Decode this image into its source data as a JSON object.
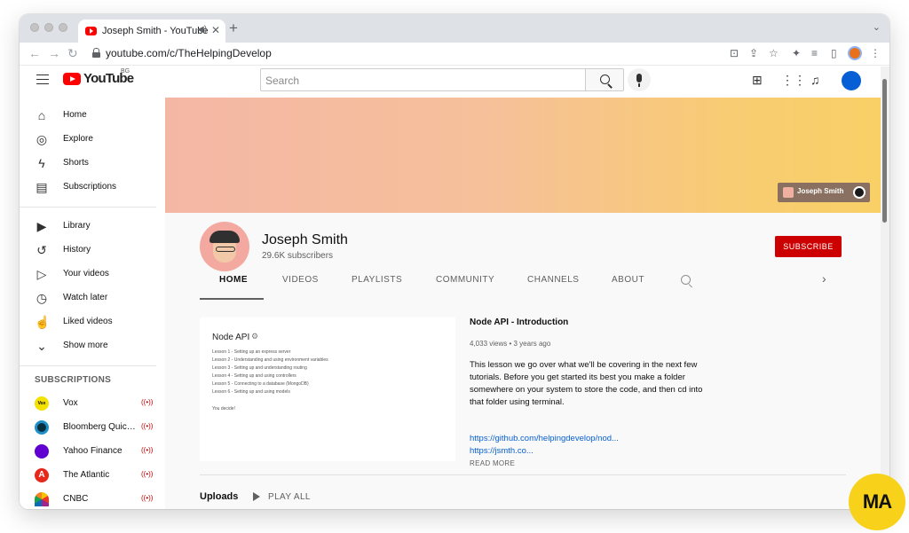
{
  "browser": {
    "tab_title": "Joseph Smith - YouTube",
    "tab_close": "✕",
    "new_tab": "+",
    "url": "youtube.com/c/TheHelpingDevelop"
  },
  "header": {
    "logo_text": "YouTube",
    "country_code": "BG",
    "search_placeholder": "Search"
  },
  "sidebar": {
    "main": [
      {
        "label": "Home",
        "icon": "home-icon"
      },
      {
        "label": "Explore",
        "icon": "explore-icon"
      },
      {
        "label": "Shorts",
        "icon": "shorts-icon"
      },
      {
        "label": "Subscriptions",
        "icon": "subscriptions-icon"
      }
    ],
    "library": [
      {
        "label": "Library",
        "icon": "library-icon"
      },
      {
        "label": "History",
        "icon": "history-icon"
      },
      {
        "label": "Your videos",
        "icon": "your-videos-icon"
      },
      {
        "label": "Watch later",
        "icon": "watch-later-icon"
      },
      {
        "label": "Liked videos",
        "icon": "liked-videos-icon"
      },
      {
        "label": "Show more",
        "icon": "chevron-down-icon"
      }
    ],
    "subscriptions_heading": "SUBSCRIPTIONS",
    "subscriptions": [
      {
        "label": "Vox",
        "color": "#f5e100",
        "avatar_text": "Vox"
      },
      {
        "label": "Bloomberg Quickt…",
        "color": "#0b2e3f",
        "avatar_text": ""
      },
      {
        "label": "Yahoo Finance",
        "color": "#6001d2",
        "avatar_text": ""
      },
      {
        "label": "The Atlantic",
        "color": "#e7271c",
        "avatar_text": "A"
      },
      {
        "label": "CNBC",
        "color": "#ffffff",
        "avatar_text": ""
      }
    ]
  },
  "banner": {
    "link_text": "Joseph Smith"
  },
  "channel": {
    "name": "Joseph Smith",
    "subscribers": "29.6K subscribers",
    "subscribe_label": "SUBSCRIBE",
    "tabs": [
      "HOME",
      "VIDEOS",
      "PLAYLISTS",
      "COMMUNITY",
      "CHANNELS",
      "ABOUT"
    ]
  },
  "featured": {
    "thumb_title": "Node API",
    "thumb_lines": [
      "Lesson 1 - Setting up an express server",
      "Lesson 2 - Understanding and using environment variables",
      "Lesson 3 - Setting up and understanding routing",
      "Lesson 4 - Setting up and using controllers",
      "Lesson 5 - Connecting to a database (MongoDB)",
      "Lesson 6 - Setting up and using models",
      "You decide!"
    ],
    "title": "Node API - Introduction",
    "meta": "4,033 views • 3 years ago",
    "description": "This lesson we go over what we'll be covering in the next few tutorials. Before you get started its best you make a folder somewhere on your system to store the code, and then cd into that folder using terminal.",
    "link1": "https://github.com/helpingdevelop/nod...",
    "link2": "https://jsmth.co...",
    "read_more": "READ MORE"
  },
  "uploads": {
    "heading": "Uploads",
    "play_all": "PLAY ALL"
  },
  "badge": {
    "text": "MA"
  },
  "colors": {
    "accent_red": "#cc0000",
    "link_blue": "#065fd4",
    "banner_start": "#f4b7a5",
    "banner_end": "#f8d066"
  }
}
